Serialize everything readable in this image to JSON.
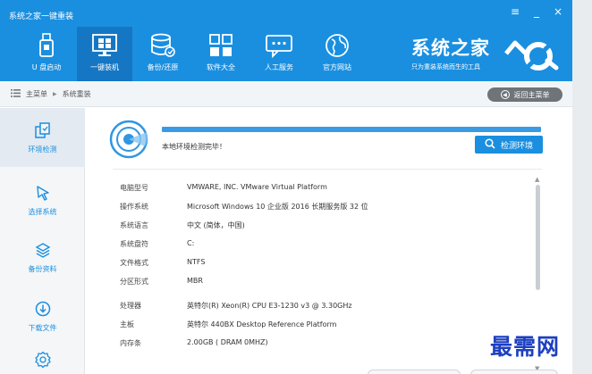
{
  "window": {
    "title": "系统之家一键重装",
    "controls": [
      "≡",
      "_",
      "×"
    ]
  },
  "toolbar": {
    "items": [
      {
        "label": "U 盘启动",
        "icon": "usb-drive-icon"
      },
      {
        "label": "一键装机",
        "icon": "monitor-icon",
        "active": true
      },
      {
        "label": "备份/还原",
        "icon": "database-icon"
      },
      {
        "label": "软件大全",
        "icon": "app-grid-icon"
      },
      {
        "label": "人工服务",
        "icon": "chat-bubble-icon"
      },
      {
        "label": "官方网站",
        "icon": "globe-icon"
      }
    ]
  },
  "brand": {
    "name": "系统之家",
    "tagline": "只为重装系统而生的工具"
  },
  "breadcrumb": {
    "icon": "list-icon",
    "items": [
      "主菜单",
      "系统重装"
    ],
    "back_label": "返回主菜单"
  },
  "sidebar": {
    "items": [
      {
        "label": "环境检测",
        "icon": "copy-pages-icon",
        "active": true
      },
      {
        "label": "选择系统",
        "icon": "cursor-icon"
      },
      {
        "label": "备份资料",
        "icon": "layers-icon"
      },
      {
        "label": "下载文件",
        "icon": "download-icon"
      },
      {
        "label": "",
        "icon": "settings-gear-icon"
      }
    ]
  },
  "main": {
    "status_text": "本地环境检测完毕！",
    "progress": 1.0,
    "check_button": "检测环境",
    "info": [
      {
        "key": "电脑型号",
        "value": "VMWARE, INC. VMware Virtual Platform"
      },
      {
        "key": "操作系统",
        "value": "Microsoft Windows 10 企业版 2016 长期服务版 32 位"
      },
      {
        "key": "系统语言",
        "value": "中文 (简体，中国)"
      },
      {
        "key": "系统盘符",
        "value": "C:"
      },
      {
        "key": "文件格式",
        "value": "NTFS"
      },
      {
        "key": "分区形式",
        "value": "MBR"
      },
      {
        "key": "处理器",
        "value": "英特尔(R) Xeon(R) CPU E3-1230 v3 @ 3.30GHz"
      },
      {
        "key": "主板",
        "value": "英特尔 440BX Desktop Reference Platform"
      },
      {
        "key": "内存条",
        "value": "2.00GB ( DRAM 0MHZ)"
      }
    ]
  },
  "watermark": "最需网",
  "colors": {
    "header_blue": "#1a8fe0",
    "active_blue": "#1577c4",
    "sidebar_bg": "#f4f6f8"
  }
}
